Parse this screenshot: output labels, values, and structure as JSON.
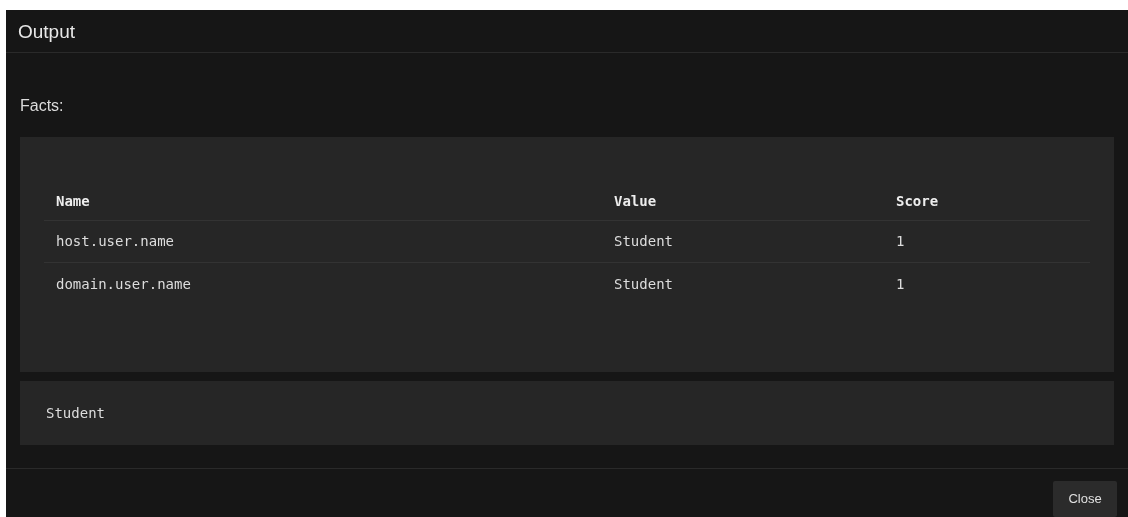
{
  "dialog": {
    "title": "Output"
  },
  "facts": {
    "label": "Facts:",
    "table": {
      "columns": [
        "Name",
        "Value",
        "Score"
      ],
      "rows": [
        [
          "host.user.name",
          "Student",
          "1"
        ],
        [
          "domain.user.name",
          "Student",
          "1"
        ]
      ]
    }
  },
  "result": "Student",
  "buttons": [
    "Close"
  ]
}
